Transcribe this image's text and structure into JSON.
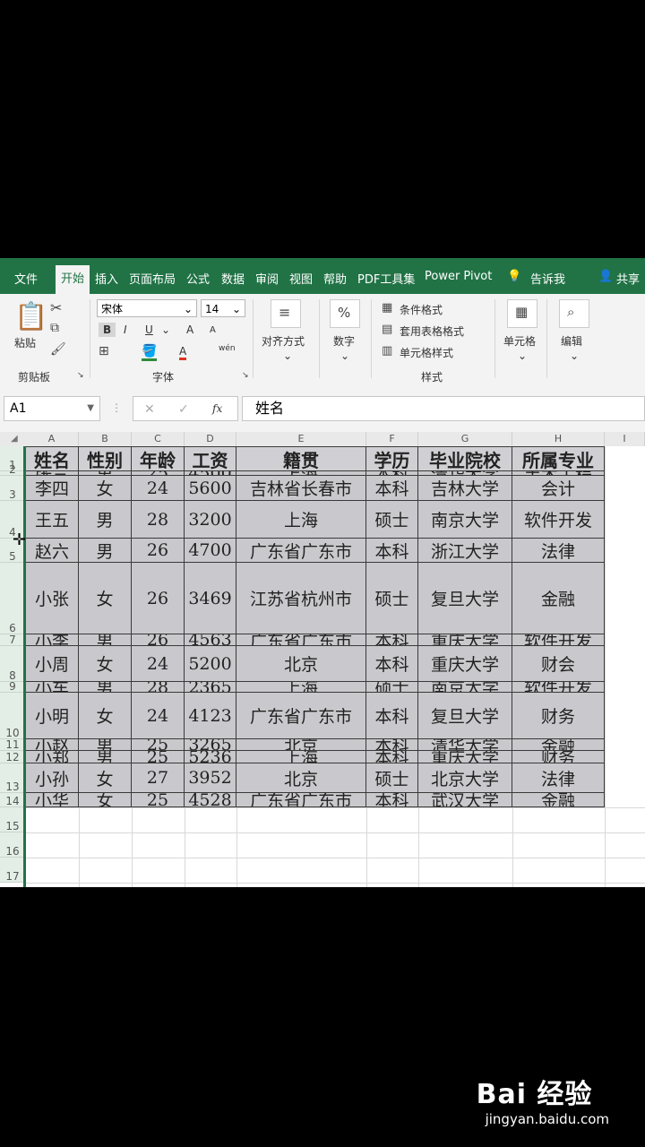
{
  "tabs": [
    "文件",
    "开始",
    "插入",
    "页面布局",
    "公式",
    "数据",
    "审阅",
    "视图",
    "帮助",
    "PDF工具集",
    "Power Pivot",
    "告诉我",
    "共享"
  ],
  "ribbon": {
    "paste": "粘贴",
    "clipboard_group": "剪贴板",
    "font_name": "宋体",
    "font_size": "14",
    "font_group": "字体",
    "bold": "B",
    "italic": "I",
    "underline": "U",
    "grow": "A",
    "shrink": "A",
    "color_a": "A",
    "phonetic": "wén",
    "align": "对齐方式",
    "number_symbol": "%",
    "number": "数字",
    "cond_format": "条件格式",
    "table_format": "套用表格格式",
    "cell_style": "单元格样式",
    "style_group": "样式",
    "cells": "单元格",
    "edit": "编辑"
  },
  "formula_bar": {
    "name_box": "A1",
    "cancel": "✕",
    "enter": "✓",
    "fx": "fx",
    "content": "姓名"
  },
  "columns": [
    "A",
    "B",
    "C",
    "D",
    "E",
    "F",
    "G",
    "H",
    "I"
  ],
  "row_numbers": [
    "1",
    "2",
    "3",
    "4",
    "5",
    "6",
    "7",
    "8",
    "9",
    "10",
    "11",
    "12",
    "13",
    "14",
    "15",
    "16",
    "17"
  ],
  "table": {
    "headers": [
      "姓名",
      "性别",
      "年龄",
      "工资",
      "籍贯",
      "学历",
      "毕业院校",
      "所属专业"
    ],
    "rows": [
      [
        "张三",
        "男",
        "25",
        "4500",
        "上海",
        "本科",
        "清华大学",
        "土木工程"
      ],
      [
        "李四",
        "女",
        "24",
        "5600",
        "吉林省长春市",
        "本科",
        "吉林大学",
        "会计"
      ],
      [
        "王五",
        "男",
        "28",
        "3200",
        "上海",
        "硕士",
        "南京大学",
        "软件开发"
      ],
      [
        "赵六",
        "男",
        "26",
        "4700",
        "广东省广东市",
        "本科",
        "浙江大学",
        "法律"
      ],
      [
        "小张",
        "女",
        "26",
        "3469",
        "江苏省杭州市",
        "硕士",
        "复旦大学",
        "金融"
      ],
      [
        "小李",
        "男",
        "26",
        "4563",
        "广东省广东市",
        "本科",
        "重庆大学",
        "软件开发"
      ],
      [
        "小周",
        "女",
        "24",
        "5200",
        "北京",
        "本科",
        "重庆大学",
        "财会"
      ],
      [
        "小车",
        "男",
        "28",
        "2365",
        "上海",
        "硕士",
        "南京大学",
        "软件开发"
      ],
      [
        "小明",
        "女",
        "24",
        "4123",
        "广东省广东市",
        "本科",
        "复旦大学",
        "财务"
      ],
      [
        "小赵",
        "男",
        "25",
        "3265",
        "北京",
        "本科",
        "清华大学",
        "金融"
      ],
      [
        "小郑",
        "男",
        "25",
        "5236",
        "上海",
        "本科",
        "重庆大学",
        "财务"
      ],
      [
        "小孙",
        "女",
        "27",
        "3952",
        "北京",
        "硕士",
        "北京大学",
        "法律"
      ],
      [
        "小华",
        "女",
        "25",
        "4528",
        "广东省广东市",
        "本科",
        "武汉大学",
        "金融"
      ]
    ]
  },
  "watermark": {
    "brand": "Bai 经验",
    "url": "jingyan.baidu.com"
  }
}
